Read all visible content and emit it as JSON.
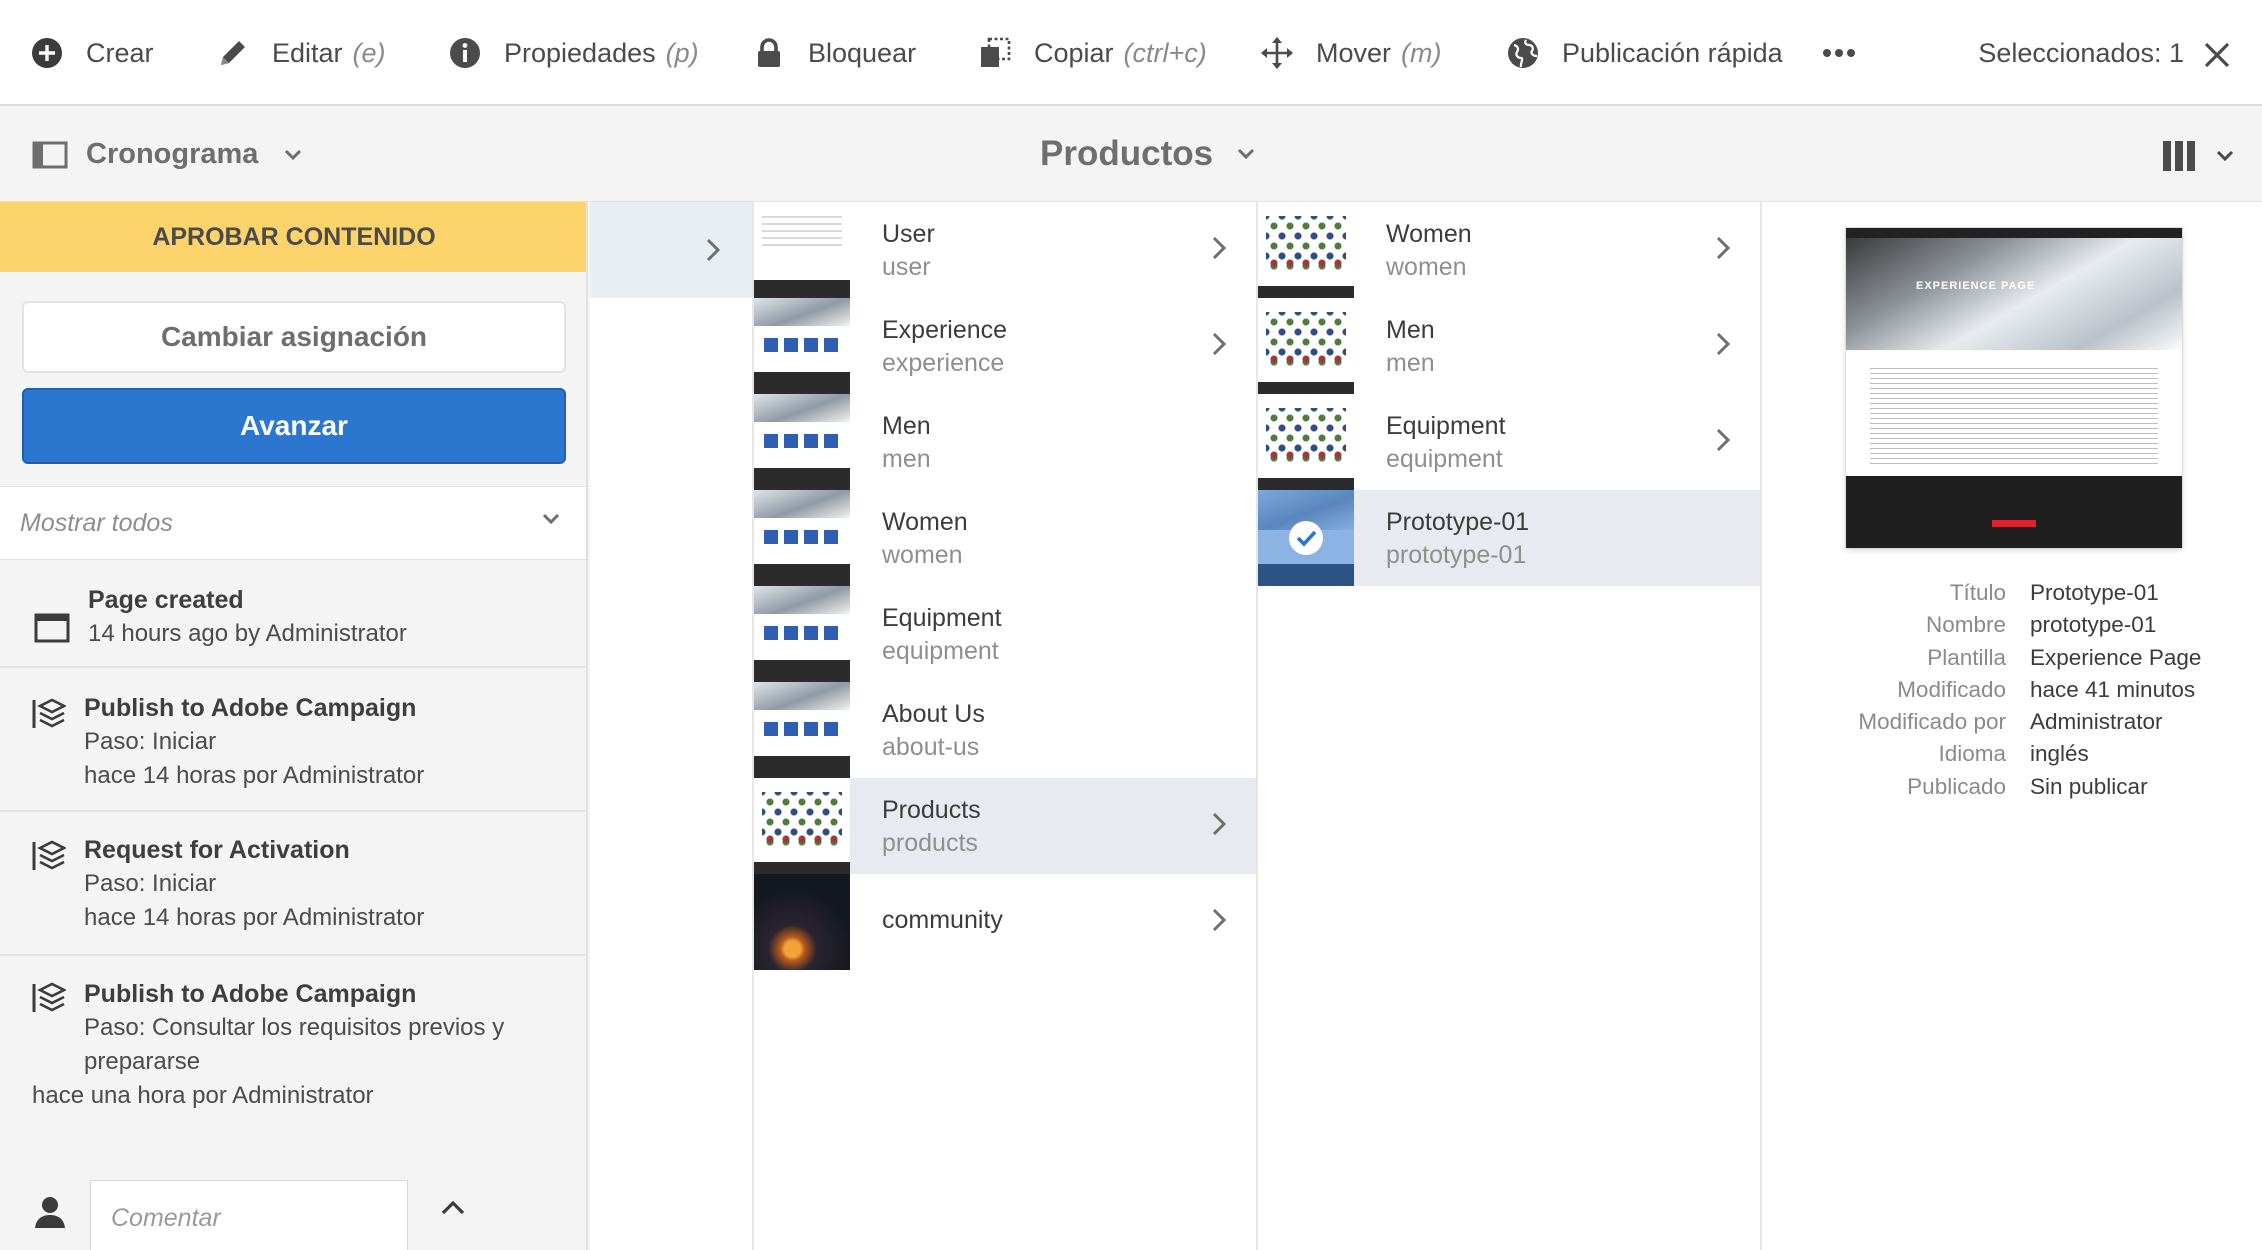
{
  "toolbar": {
    "items": [
      {
        "label": "Crear",
        "shortcut": "",
        "icon": "add-circle-icon"
      },
      {
        "label": "Editar",
        "shortcut": "(e)",
        "icon": "pencil-icon"
      },
      {
        "label": "Propiedades",
        "shortcut": "(p)",
        "icon": "info-icon"
      },
      {
        "label": "Bloquear",
        "shortcut": "",
        "icon": "lock-icon"
      },
      {
        "label": "Copiar",
        "shortcut": "(ctrl+c)",
        "icon": "copy-icon"
      },
      {
        "label": "Mover",
        "shortcut": "(m)",
        "icon": "move-icon"
      },
      {
        "label": "Publicación rápida",
        "shortcut": "",
        "icon": "globe-icon"
      }
    ],
    "more_icon": "more-icon",
    "selected_text": "Seleccionados: 1"
  },
  "header": {
    "rail_label": "Cronograma",
    "title": "Productos"
  },
  "rail": {
    "approve_banner": "APROBAR CONTENIDO",
    "reassign_label": "Cambiar asignación",
    "advance_label": "Avanzar",
    "filter_value": "Mostrar todos",
    "timeline": [
      {
        "icon": "page-icon",
        "title": "Page created",
        "lines": [
          "14 hours ago by Administrator"
        ]
      },
      {
        "icon": "workflow-icon",
        "title": "Publish to Adobe Campaign",
        "lines": [
          "Paso: Iniciar",
          "hace 14 horas por Administrator"
        ]
      },
      {
        "icon": "workflow-icon",
        "title": "Request for Activation",
        "lines": [
          "Paso: Iniciar",
          "hace 14 horas por Administrator"
        ]
      },
      {
        "icon": "workflow-icon",
        "title": "Publish to Adobe Campaign",
        "lines": [
          "Paso: Consultar los requisitos previos y",
          "prepararse",
          "hace una hora por Administrator"
        ]
      }
    ],
    "comment_placeholder": "Comentar"
  },
  "columns": {
    "col1": [
      {
        "title": "User",
        "name": "user",
        "thumb": "page",
        "has_children": true
      },
      {
        "title": "Experience",
        "name": "experience",
        "thumb": "experience",
        "has_children": true
      },
      {
        "title": "Men",
        "name": "men",
        "thumb": "experience",
        "has_children": false
      },
      {
        "title": "Women",
        "name": "women",
        "thumb": "experience",
        "has_children": false
      },
      {
        "title": "Equipment",
        "name": "equipment",
        "thumb": "experience",
        "has_children": false
      },
      {
        "title": "About Us",
        "name": "about-us",
        "thumb": "experience",
        "has_children": false
      },
      {
        "title": "Products",
        "name": "products",
        "thumb": "products",
        "has_children": true,
        "selected": true
      },
      {
        "title": "community",
        "name": "",
        "thumb": "community",
        "has_children": true
      }
    ],
    "col2": [
      {
        "title": "Women",
        "name": "women",
        "thumb": "products",
        "has_children": true
      },
      {
        "title": "Men",
        "name": "men",
        "thumb": "products",
        "has_children": true
      },
      {
        "title": "Equipment",
        "name": "equipment",
        "thumb": "products",
        "has_children": true
      },
      {
        "title": "Prototype-01",
        "name": "prototype-01",
        "thumb": "checked",
        "has_children": false,
        "selected": true
      }
    ]
  },
  "preview": {
    "hero_text": "EXPERIENCE PAGE",
    "properties": [
      {
        "label": "Título",
        "value": "Prototype-01"
      },
      {
        "label": "Nombre",
        "value": "prototype-01"
      },
      {
        "label": "Plantilla",
        "value": "Experience Page"
      },
      {
        "label": "Modificado",
        "value": "hace 41 minutos"
      },
      {
        "label": "Modificado por",
        "value": "Administrator"
      },
      {
        "label": "Idioma",
        "value": "inglés"
      },
      {
        "label": "Publicado",
        "value": "Sin publicar"
      }
    ]
  },
  "colors": {
    "banner": "#fdd46b",
    "primary": "#2b77cf",
    "selected_row": "#e7ebf1"
  }
}
